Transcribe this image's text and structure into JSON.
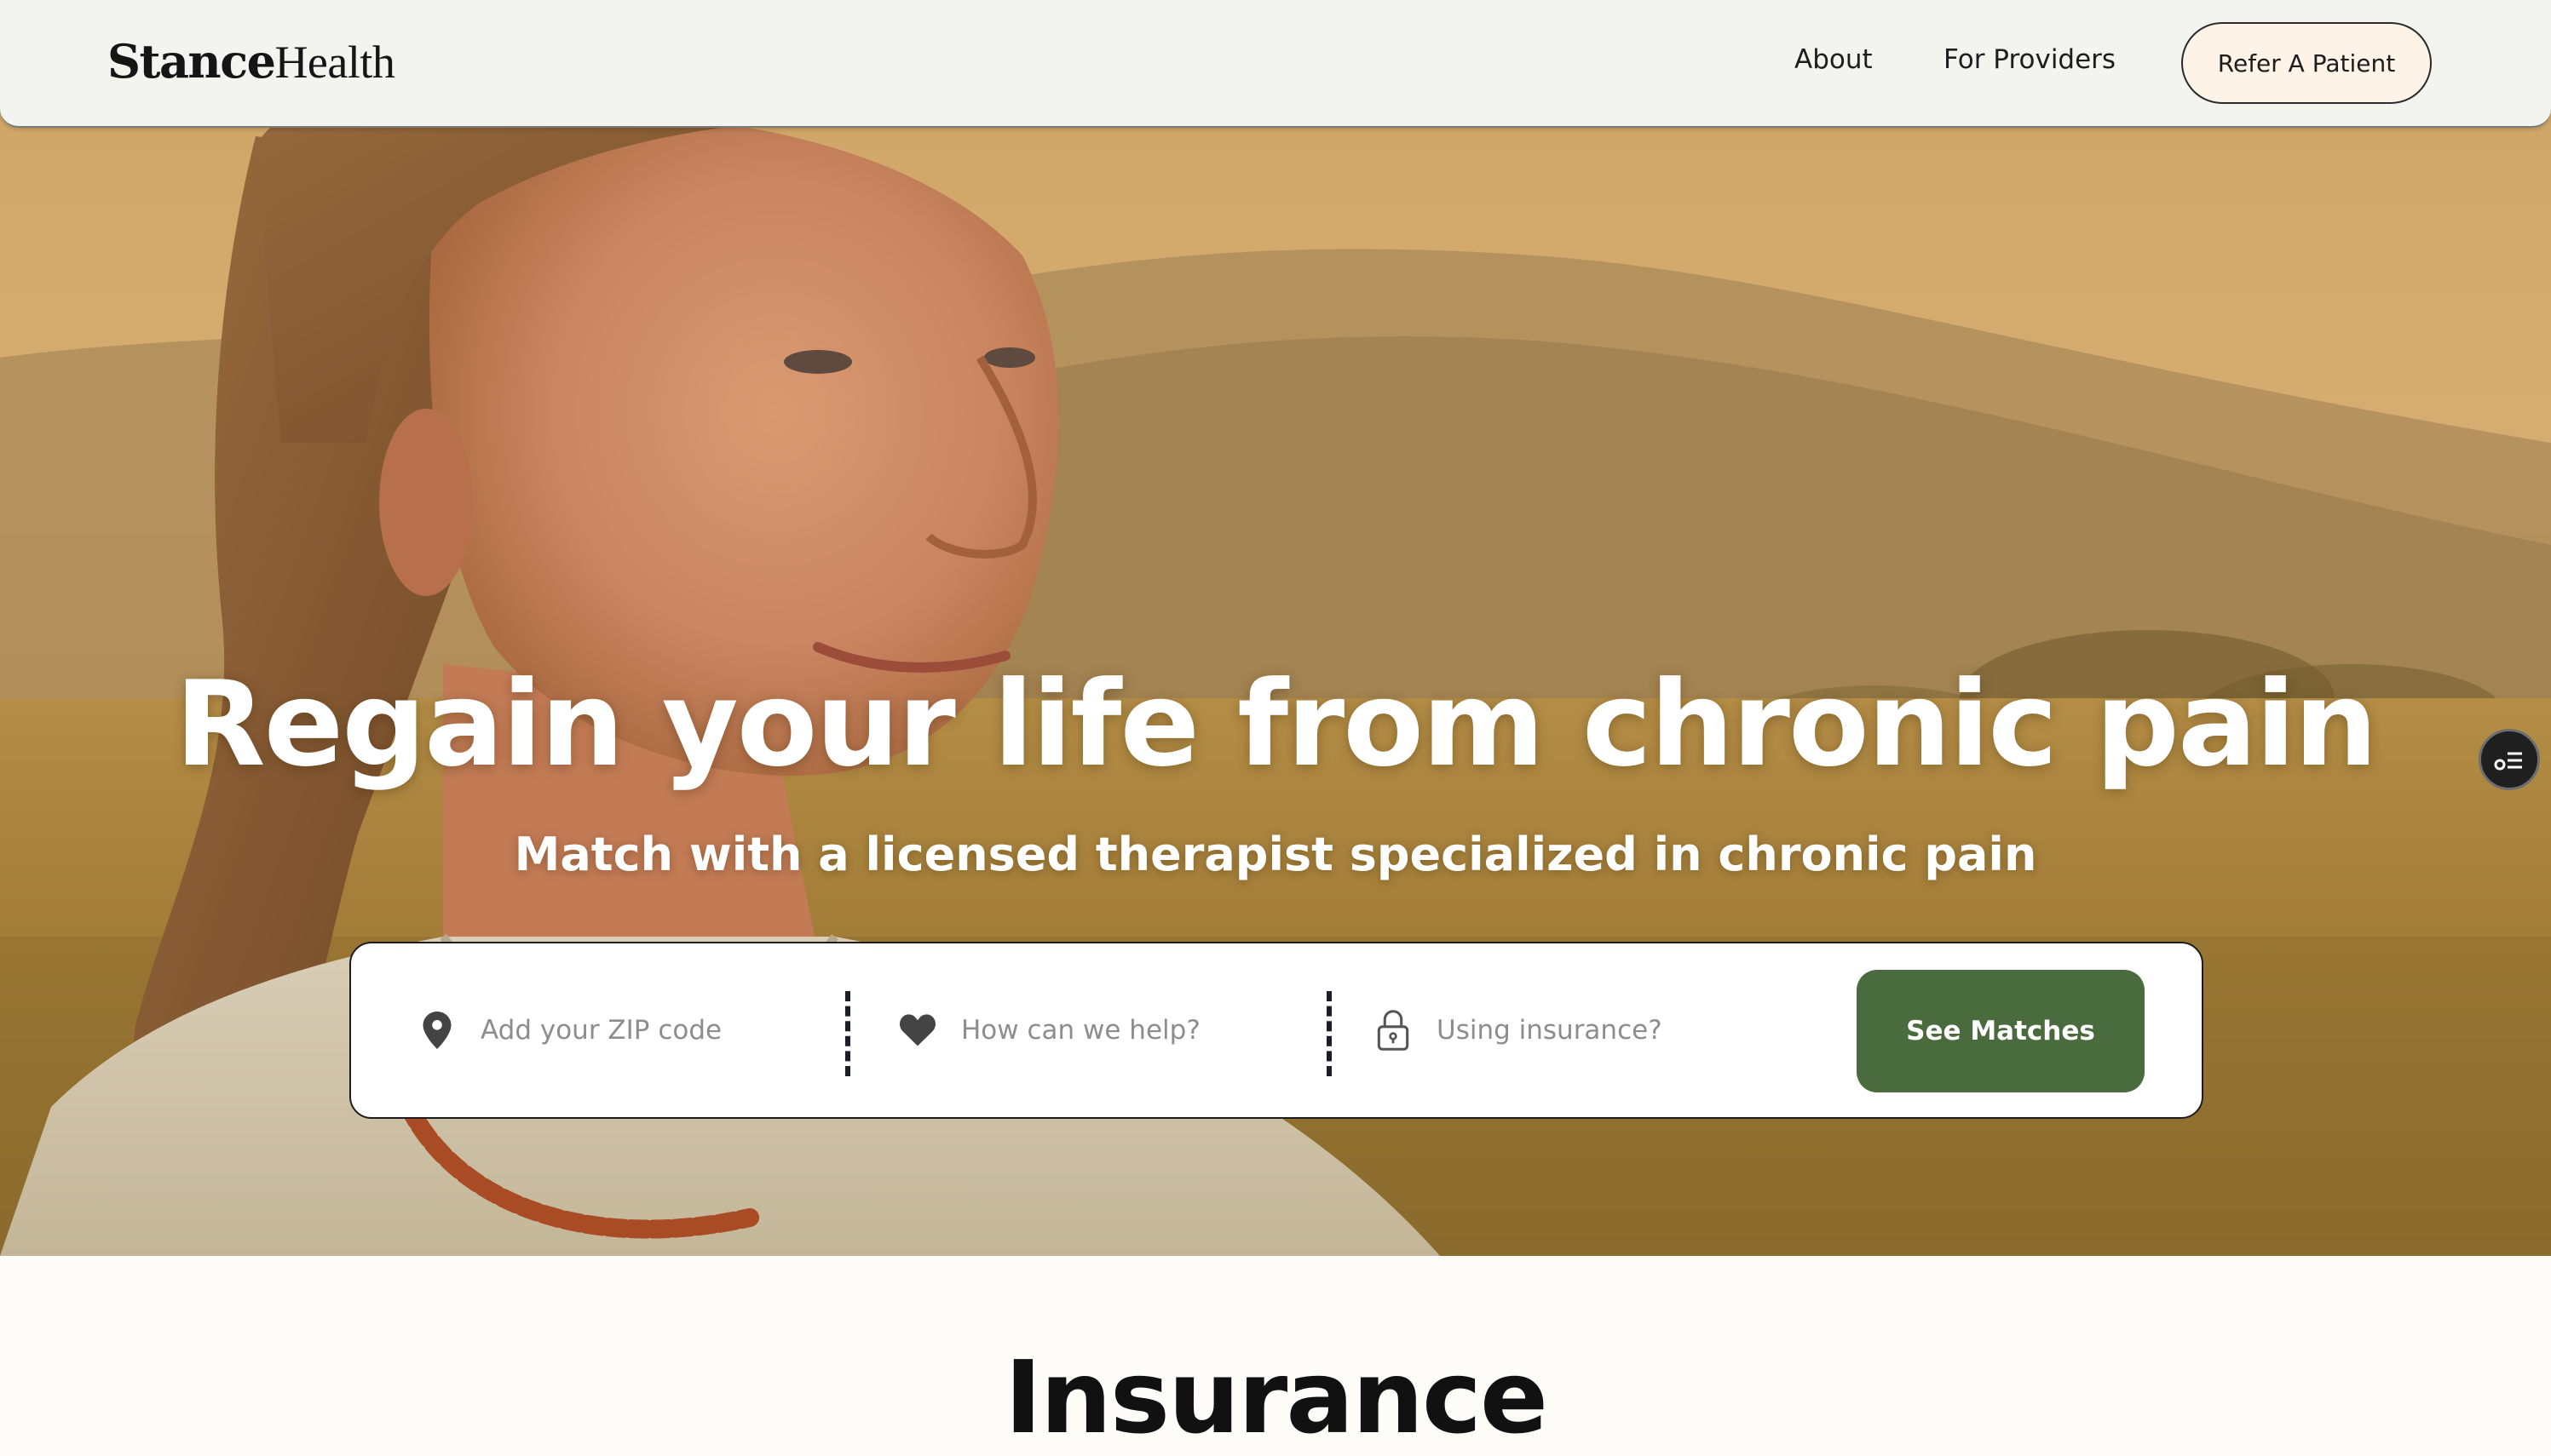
{
  "brand": {
    "name_part1": "Stance",
    "name_part2": "Health"
  },
  "nav": {
    "links": [
      {
        "label": "About"
      },
      {
        "label": "For Providers"
      }
    ],
    "cta_label": "Refer A Patient"
  },
  "hero": {
    "headline": "Regain your life from chronic pain",
    "subheadline": "Match with a licensed therapist specialized in chronic pain",
    "image_icon": "woman-in-field-photo"
  },
  "search": {
    "zip": {
      "placeholder": "Add your ZIP code",
      "value": "",
      "icon": "location-pin-icon"
    },
    "help": {
      "placeholder": "How can we help?",
      "value": "",
      "icon": "heart-icon"
    },
    "insurance": {
      "placeholder": "Using insurance?",
      "value": "",
      "icon": "lock-icon"
    },
    "submit_label": "See Matches"
  },
  "floating": {
    "icon": "accessibility-menu-icon"
  },
  "sections": {
    "insurance_title": "Insurance"
  },
  "colors": {
    "nav_bg": "#f3f4ef",
    "cta_bg": "#fdf3e6",
    "primary_green": "#4a6b3d",
    "page_bg": "#fdfcf8",
    "text_dark": "#111111"
  }
}
